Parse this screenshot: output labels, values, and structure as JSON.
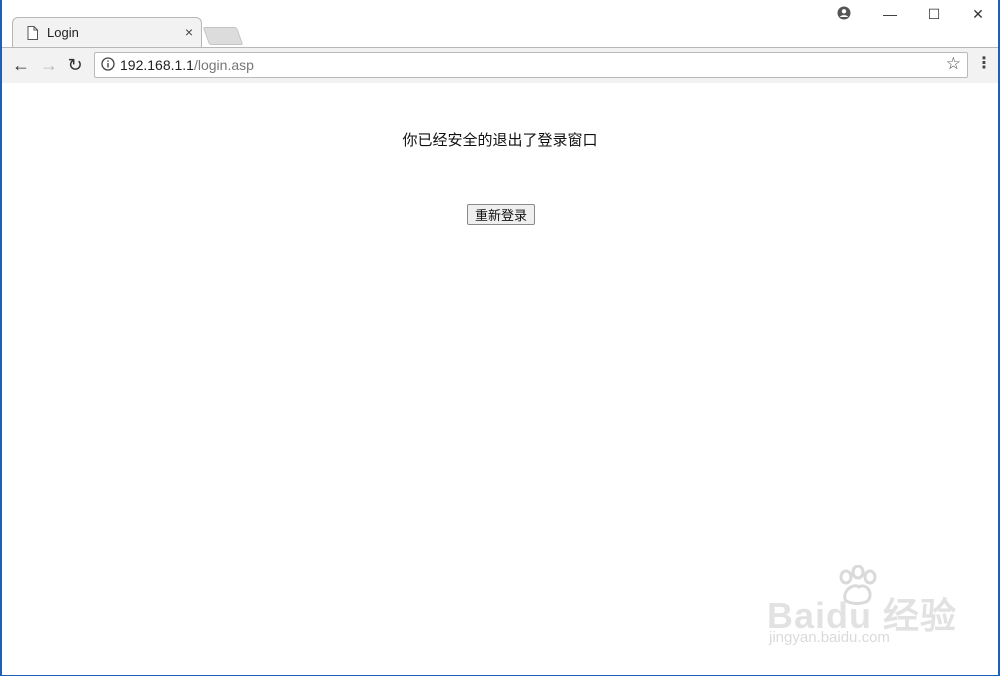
{
  "browser": {
    "tab": {
      "title": "Login",
      "close_glyph": "×"
    },
    "window_controls": {
      "minimize": "—",
      "maximize": "☐",
      "close": "✕"
    },
    "nav": {
      "back": "←",
      "forward": "→",
      "reload": "↻"
    },
    "address": {
      "host": "192.168.1.1",
      "path": "/login.asp"
    },
    "bookmark_glyph": "☆",
    "menu_glyph": "⋮"
  },
  "page": {
    "message": "你已经安全的退出了登录窗口",
    "relogin_button": "重新登录"
  },
  "watermark": {
    "brand": "Baidu 经验",
    "url": "jingyan.baidu.com"
  }
}
